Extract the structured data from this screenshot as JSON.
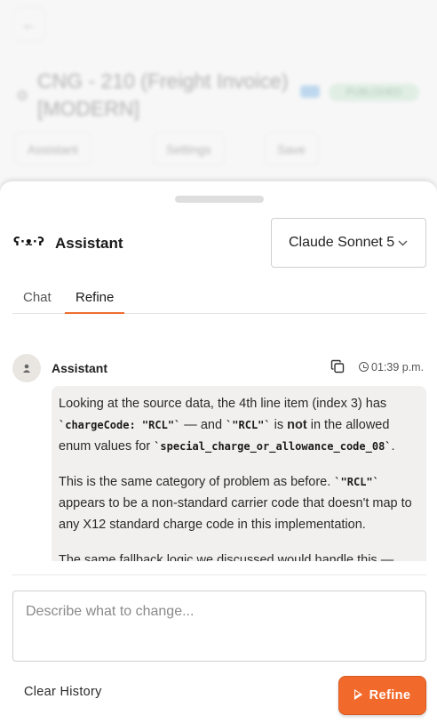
{
  "background": {
    "back_icon": "←",
    "title": "CNG - 210 (Freight Invoice) [MODERN]",
    "status_badge": "PUBLISHED",
    "buttons": [
      "Assistant",
      "Settings",
      "Save"
    ]
  },
  "header": {
    "icon_glyph": "ʕ·ᴥ·ʔ",
    "title": "Assistant",
    "model_selected": "Claude Sonnet 5"
  },
  "tabs": [
    {
      "label": "Chat",
      "active": false
    },
    {
      "label": "Refine",
      "active": true
    }
  ],
  "message": {
    "sender": "Assistant",
    "time": "01:39 p.m.",
    "p1_a": "Looking at the source data, the 4th line item (index 3) has ",
    "p1_code1": "`chargeCode: \"RCL\"`",
    "p1_b": " — and ",
    "p1_code2": "`\"RCL\"`",
    "p1_c": " is ",
    "p1_bold": "not",
    "p1_d": " in the allowed enum values for ",
    "p1_code3": "`special_charge_or_allowance_code_08`",
    "p1_e": ".",
    "p2_a": "This is the same category of problem as before. ",
    "p2_code": "`\"RCL\"`",
    "p2_b": " appears to be a non-standard carrier code that doesn't map to any X12 standard charge code in this implementation.",
    "p3": "The same fallback logic we discussed would handle this —"
  },
  "composer": {
    "placeholder": "Describe what to change...",
    "clear_label": "Clear History",
    "refine_label": "Refine"
  },
  "colors": {
    "accent": "#f26a2b",
    "bubble_bg": "#f1f0ee"
  }
}
